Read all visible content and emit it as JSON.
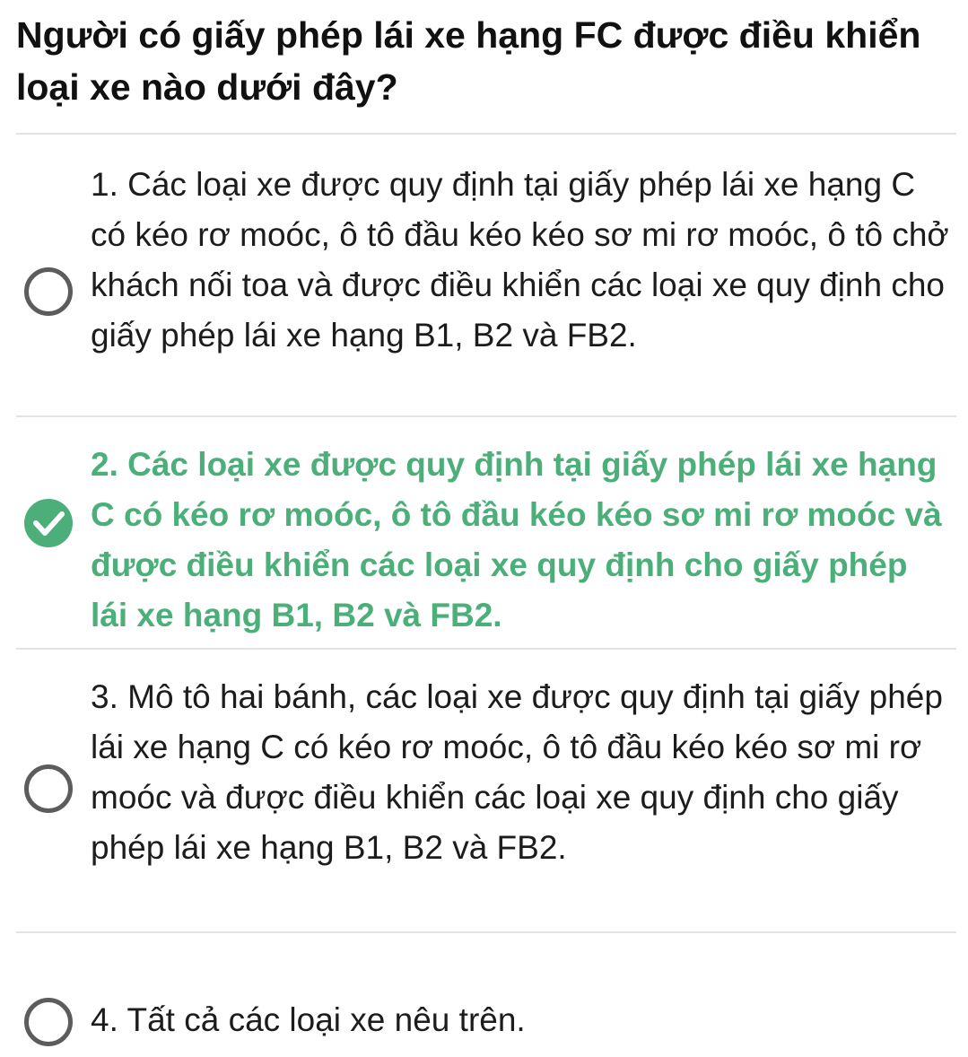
{
  "question": {
    "text": "Người có giấy phép lái xe hạng FC được điều khiển loại xe nào dưới đây?"
  },
  "options": [
    {
      "text": "1. Các loại xe được quy định tại giấy phép lái xe hạng C có kéo rơ moóc, ô tô đầu kéo kéo sơ mi rơ moóc, ô tô chở khách nối toa và được điều khiển các loại xe quy định cho giấy phép lái xe hạng B1, B2 và FB2.",
      "selected": false
    },
    {
      "text": "2. Các loại xe được quy định tại giấy phép lái xe hạng C có kéo rơ moóc, ô tô đầu kéo kéo sơ mi rơ moóc và được điều khiển các loại xe quy định cho giấy phép lái xe hạng B1, B2 và FB2.",
      "selected": true,
      "icon": "checkmark-icon"
    },
    {
      "text": "3. Mô tô hai bánh, các loại xe được quy định tại giấy phép lái xe hạng C có kéo rơ moóc, ô tô đầu kéo kéo sơ mi rơ moóc và được điều khiển các loại xe quy định cho giấy phép lái xe hạng B1, B2 và FB2.",
      "selected": false
    },
    {
      "text": "4. Tất cả các loại xe nêu trên.",
      "selected": false
    }
  ],
  "colors": {
    "correct": "#4caf7a",
    "radio_border": "#5c5c5c",
    "divider": "#e3e3e3",
    "text": "#1c1c1c"
  }
}
